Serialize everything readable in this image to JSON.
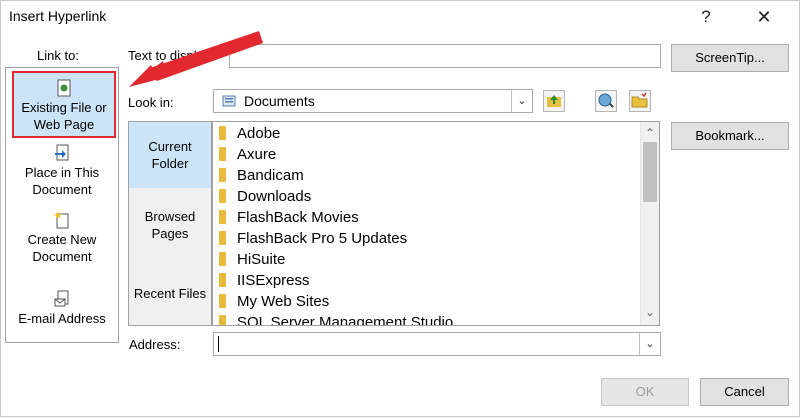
{
  "window": {
    "title": "Insert Hyperlink",
    "help": "?",
    "close": "✕"
  },
  "link_to": {
    "label": "Link to:",
    "items": [
      {
        "label_line1": "Existing File or",
        "label_line2": "Web Page",
        "icon": "web-page-icon",
        "selected": true
      },
      {
        "label_line1": "Place in This",
        "label_line2": "Document",
        "icon": "place-in-document-icon",
        "selected": false
      },
      {
        "label_line1": "Create New",
        "label_line2": "Document",
        "icon": "new-document-icon",
        "selected": false
      },
      {
        "label_line1": "E-mail Address",
        "label_line2": "",
        "icon": "email-icon",
        "selected": false
      }
    ]
  },
  "text_to_display": {
    "label": "Text to display:",
    "value": ""
  },
  "screentip_label": "ScreenTip...",
  "look_in": {
    "label": "Look in:",
    "value": "Documents"
  },
  "subnav": {
    "current_line1": "Current",
    "current_line2": "Folder",
    "browsed_line1": "Browsed",
    "browsed_line2": "Pages",
    "recent": "Recent Files"
  },
  "bookmark_label": "Bookmark...",
  "files": [
    "Adobe",
    "Axure",
    "Bandicam",
    "Downloads",
    "FlashBack Movies",
    "FlashBack Pro 5 Updates",
    "HiSuite",
    "IISExpress",
    "My Web Sites",
    "SQL Server Management Studio"
  ],
  "address": {
    "label": "Address:",
    "value": ""
  },
  "ok_label": "OK",
  "cancel_label": "Cancel",
  "colors": {
    "accent_selected": "#cce4f7",
    "highlight_red": "#e0282e",
    "folder": "#e8b93a"
  }
}
